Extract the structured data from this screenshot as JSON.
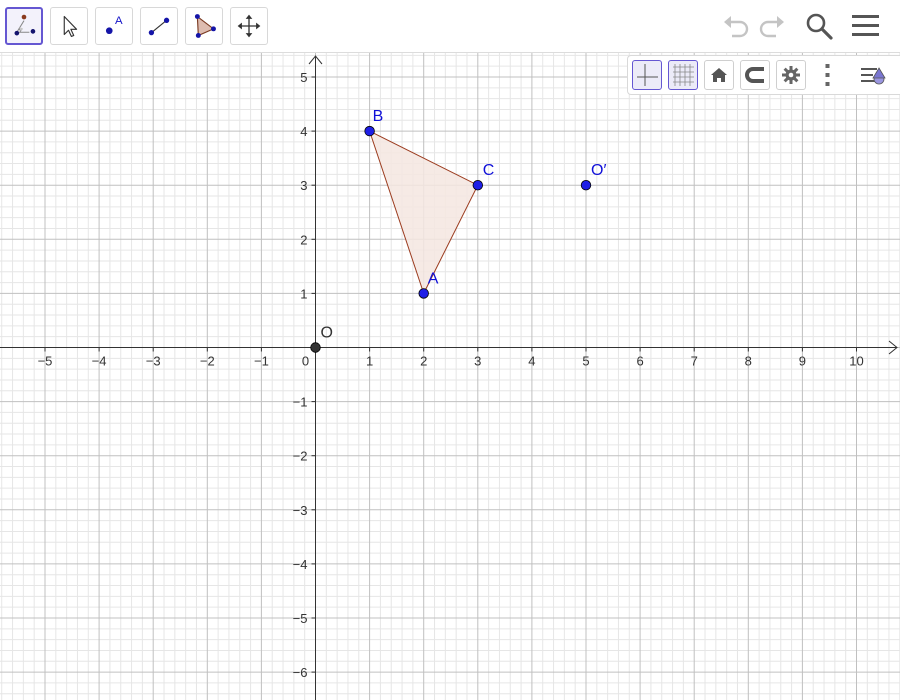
{
  "toolbar": {
    "tools": [
      {
        "name": "graphing-tools-menu",
        "icon": "point-angle-icon",
        "selected": true
      },
      {
        "name": "move-tool",
        "icon": "arrow-cursor-icon"
      },
      {
        "name": "point-tool",
        "icon": "point-icon",
        "label": "A"
      },
      {
        "name": "segment-tool",
        "icon": "segment-icon"
      },
      {
        "name": "polygon-tool",
        "icon": "polygon-icon"
      },
      {
        "name": "move-graphics-view-tool",
        "icon": "move-cross-icon"
      }
    ],
    "right_icons": [
      "undo-icon",
      "redo-icon",
      "search-icon",
      "hamburger-menu-icon"
    ]
  },
  "style_bar": {
    "buttons": [
      "axes-toggle",
      "grid-toggle",
      "standard-view",
      "point-capturing",
      "settings",
      "more-options",
      "toggle-style-bar"
    ],
    "axes_on": true,
    "grid_on": true
  },
  "graph": {
    "x_ticks": [
      "−5",
      "−4",
      "−3",
      "−2",
      "−1",
      "0",
      "1",
      "2",
      "3",
      "4",
      "5",
      "6",
      "7",
      "8",
      "9",
      "10"
    ],
    "y_ticks": [
      "5",
      "4",
      "3",
      "2",
      "1",
      "−1",
      "−2",
      "−3",
      "−4",
      "−5",
      "−6"
    ],
    "points": [
      {
        "label": "O",
        "x": 0,
        "y": 0,
        "color": "#333333"
      },
      {
        "label": "A",
        "x": 2,
        "y": 1,
        "color": "#1e1ee6"
      },
      {
        "label": "B",
        "x": 1,
        "y": 4,
        "color": "#1e1ee6"
      },
      {
        "label": "C",
        "x": 3,
        "y": 3,
        "color": "#1e1ee6"
      },
      {
        "label": "O′",
        "x": 5,
        "y": 3,
        "color": "#1e1ee6"
      }
    ],
    "polygon": {
      "vertices": [
        "A",
        "B",
        "C"
      ],
      "fill": "#f4e6e0",
      "stroke": "#9b3b1e"
    }
  },
  "colors": {
    "accent": "#6557d2",
    "point_blue": "#1e1ee6",
    "label_blue": "#1010d8",
    "origin_point": "#333333"
  }
}
